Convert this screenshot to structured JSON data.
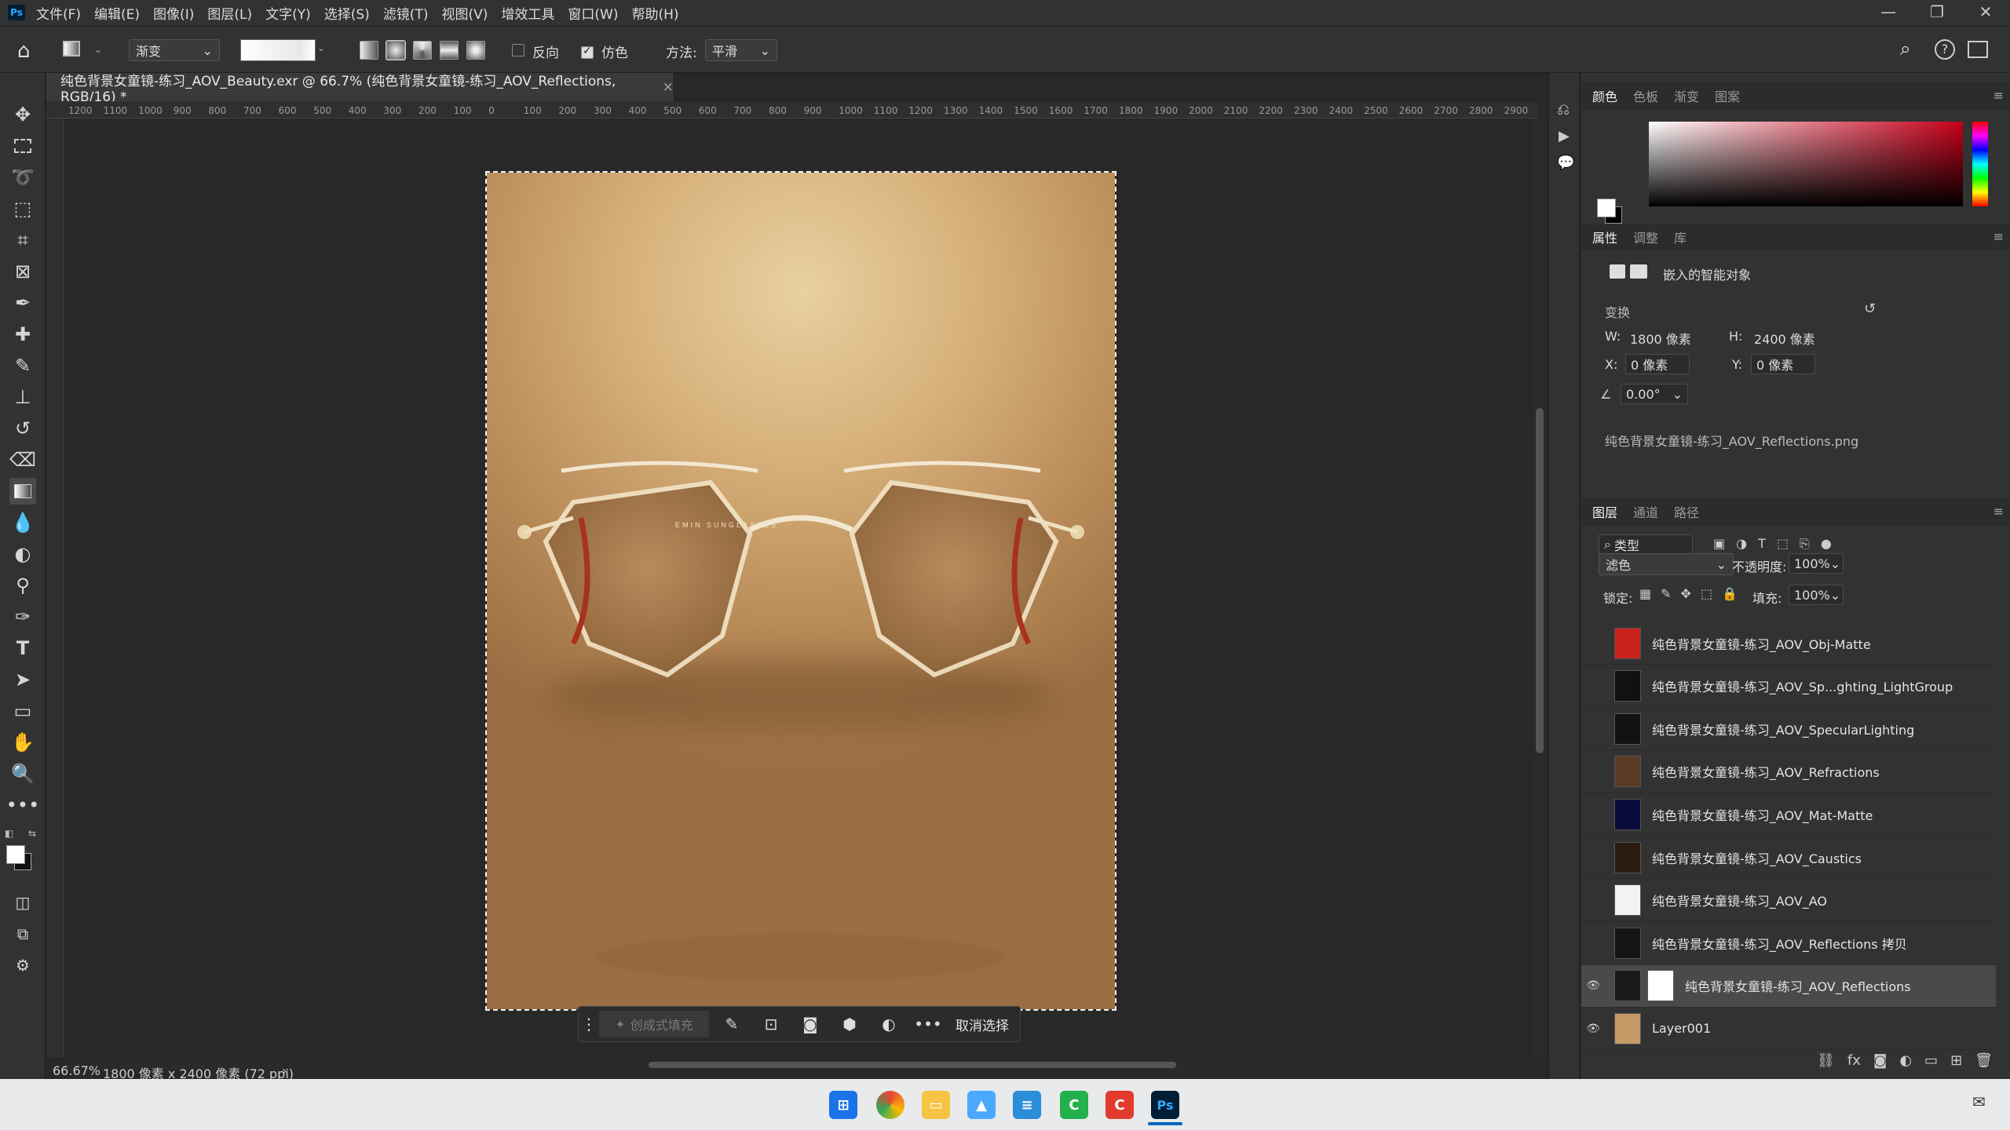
{
  "app": {
    "logo": "Ps",
    "menu": [
      "文件(F)",
      "编辑(E)",
      "图像(I)",
      "图层(L)",
      "文字(Y)",
      "选择(S)",
      "滤镜(T)",
      "视图(V)",
      "增效工具",
      "窗口(W)",
      "帮助(H)"
    ],
    "window_controls": [
      "—",
      "❐",
      "✕"
    ]
  },
  "options": {
    "tool_preset": "渐变",
    "reverse_label": "反向",
    "reverse_checked": false,
    "dither_label": "仿色",
    "dither_checked": true,
    "method_label": "方法:",
    "method_value": "平滑"
  },
  "document": {
    "tab_title": "纯色背景女童镜-练习_AOV_Beauty.exr @ 66.7% (纯色背景女童镜-练习_AOV_Reflections, RGB/16) *",
    "close": "×",
    "lens_text": "EMIN SUNGLASSES"
  },
  "ruler_h": [
    "1200",
    "1100",
    "1000",
    "900",
    "800",
    "700",
    "600",
    "500",
    "400",
    "300",
    "200",
    "100",
    "0",
    "100",
    "200",
    "300",
    "400",
    "500",
    "600",
    "700",
    "800",
    "900",
    "1000",
    "1100",
    "1200",
    "1300",
    "1400",
    "1500",
    "1600",
    "1700",
    "1800",
    "1900",
    "2000",
    "2100",
    "2200",
    "2300",
    "2400",
    "2500",
    "2600",
    "2700",
    "2800",
    "2900"
  ],
  "status": {
    "zoom": "66.67%",
    "size": "1800 像素 x 2400 像素 (72 ppi)",
    "arrow": "›"
  },
  "contextual_bar": {
    "generative_fill": "创成式填充",
    "deselect": "取消选择"
  },
  "color_panel": {
    "tabs": [
      "颜色",
      "色板",
      "渐变",
      "图案"
    ],
    "active": 0
  },
  "properties": {
    "tabs": [
      "属性",
      "调整",
      "库"
    ],
    "active": 0,
    "object_type": "嵌入的智能对象",
    "transform_label": "变换",
    "w_label": "W:",
    "w_value": "1800 像素",
    "h_label": "H:",
    "h_value": "2400 像素",
    "x_label": "X:",
    "x_value": "0 像素",
    "y_label": "Y:",
    "y_value": "0 像素",
    "angle": "0.00°",
    "linked_file": "纯色背景女童镜-练习_AOV_Reflections.png"
  },
  "layers": {
    "tabs": [
      "图层",
      "通道",
      "路径"
    ],
    "active": 0,
    "filter_kind": "类型",
    "blend_mode": "滤色",
    "opacity_label": "不透明度:",
    "opacity": "100%",
    "lock_label": "锁定:",
    "fill_label": "填充:",
    "fill": "100%",
    "items": [
      {
        "name": "纯色背景女童镜-练习_AOV_Obj-Matte",
        "visible": false,
        "thumb": "#c8221d"
      },
      {
        "name": "纯色背景女童镜-练习_AOV_Sp...ghting_LightGroup",
        "visible": false,
        "thumb": "#111111"
      },
      {
        "name": "纯色背景女童镜-练习_AOV_SpecularLighting",
        "visible": false,
        "thumb": "#121212"
      },
      {
        "name": "纯色背景女童镜-练习_AOV_Refractions",
        "visible": false,
        "thumb": "#5a3a22"
      },
      {
        "name": "纯色背景女童镜-练习_AOV_Mat-Matte",
        "visible": false,
        "thumb": "#0a0a3a"
      },
      {
        "name": "纯色背景女童镜-练习_AOV_Caustics",
        "visible": false,
        "thumb": "#2a1a10"
      },
      {
        "name": "纯色背景女童镜-练习_AOV_AO",
        "visible": false,
        "thumb": "#f2f2f2"
      },
      {
        "name": "纯色背景女童镜-练习_AOV_Reflections 拷贝",
        "visible": false,
        "thumb": "#141414"
      },
      {
        "name": "纯色背景女童镜-练习_AOV_Reflections",
        "visible": true,
        "thumb": "#1a1a1a",
        "selected": true
      },
      {
        "name": "Layer001",
        "visible": true,
        "thumb": "#c49a66"
      }
    ]
  },
  "taskbar": {
    "apps": [
      "windows-start",
      "chrome",
      "file-explorer",
      "photos",
      "notepad",
      "app-green",
      "app-red",
      "photoshop"
    ]
  }
}
